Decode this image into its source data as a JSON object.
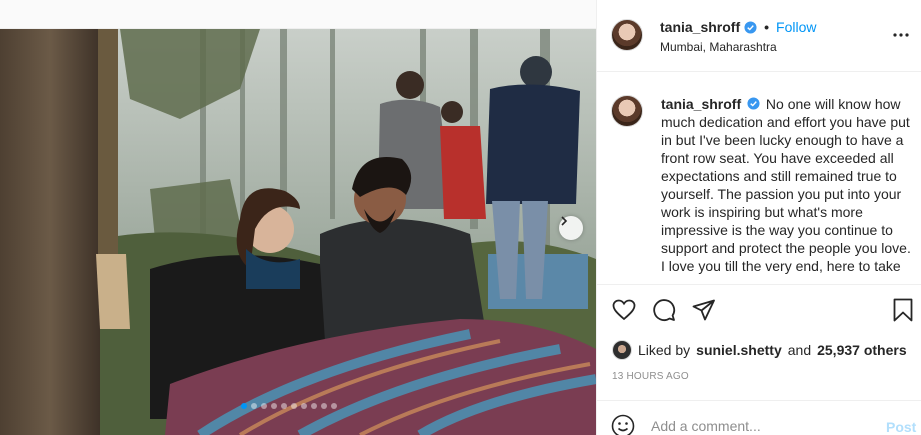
{
  "header": {
    "username": "tania_shroff",
    "separator": "•",
    "follow_label": "Follow",
    "location": "Mumbai, Maharashtra"
  },
  "caption": {
    "username": "tania_shroff",
    "text": "No one will know how much dedication and effort you have put in but I've been lucky enough to have a front row seat. You have exceeded all expectations and still remained true to yourself. The passion you put into your work is inspiring but what's more impressive is the way you continue to support and protect the people you love. I love you till the very end, here to take"
  },
  "likes": {
    "prefix": "Liked by",
    "user": "suniel.shetty",
    "conjunction": "and",
    "others": "25,937 others"
  },
  "timestamp": "13 HOURS AGO",
  "comment": {
    "placeholder": "Add a comment...",
    "post_label": "Post"
  },
  "carousel": {
    "slide_count": 10,
    "active_index": 0
  },
  "icons": {
    "verified": "verified-badge-icon",
    "more": "more-options-icon",
    "like": "heart-icon",
    "comment": "comment-bubble-icon",
    "share": "paper-plane-icon",
    "save": "bookmark-icon",
    "emoji": "smiley-icon",
    "next": "chevron-right-icon"
  },
  "colors": {
    "accent": "#0095f6",
    "muted": "#8e8e8e",
    "post_disabled": "#b2dffc"
  }
}
